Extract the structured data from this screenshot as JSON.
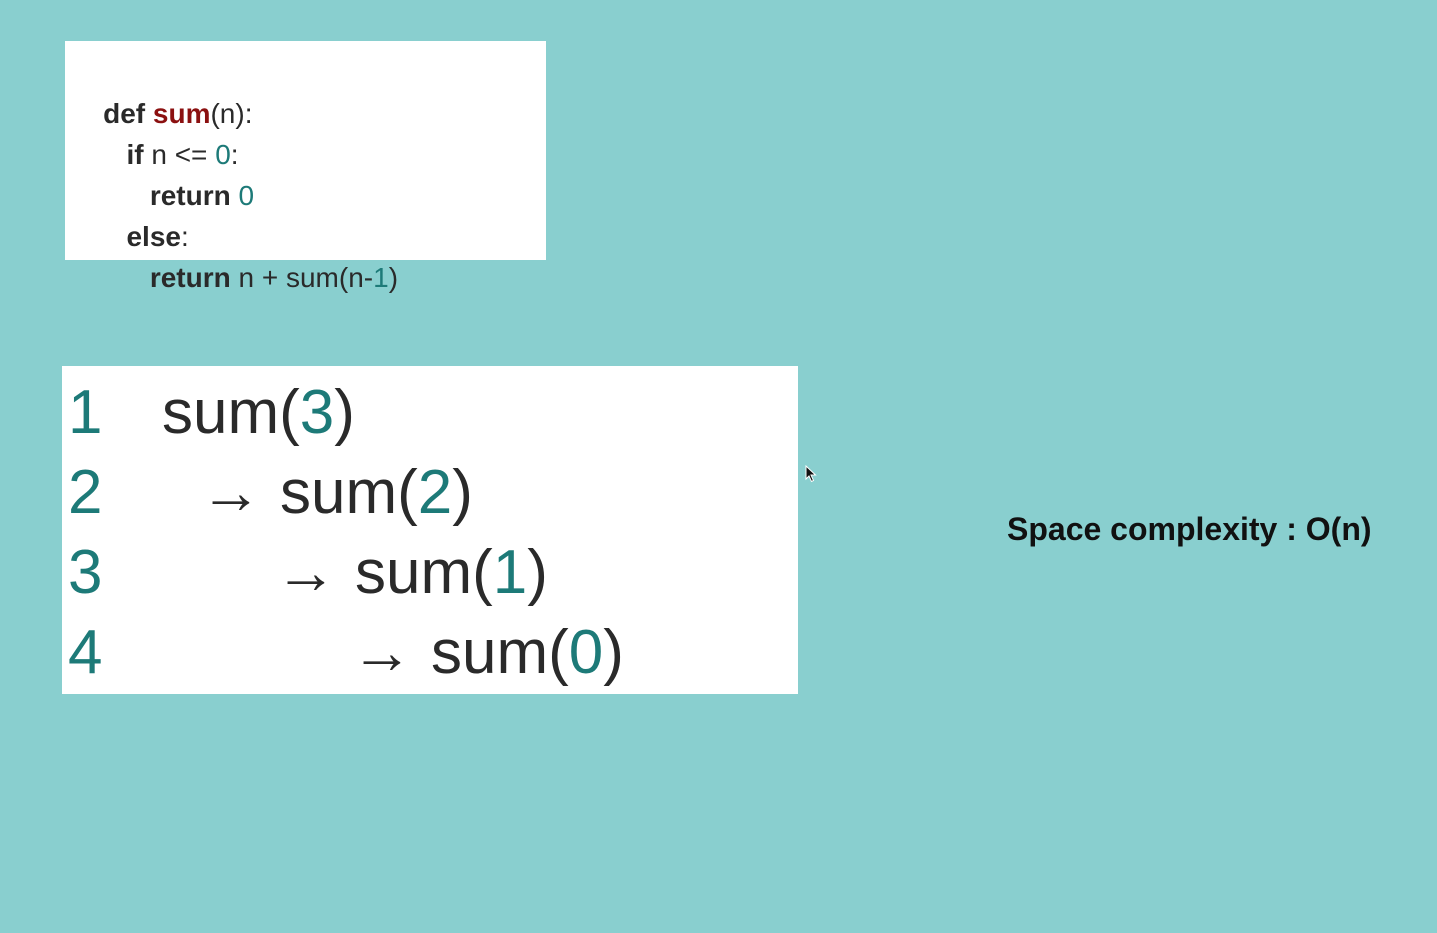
{
  "colors": {
    "background": "#89cfcf",
    "function_name": "#8b1010",
    "number": "#1d7a78",
    "text": "#2a2a2a"
  },
  "code": {
    "lines": [
      {
        "tokens": [
          {
            "text": "def ",
            "style": "kw"
          },
          {
            "text": "sum",
            "style": "fn"
          },
          {
            "text": "(n):",
            "style": "plain"
          }
        ]
      },
      {
        "tokens": [
          {
            "text": "   ",
            "style": "plain"
          },
          {
            "text": "if",
            "style": "kw"
          },
          {
            "text": " n <= ",
            "style": "plain"
          },
          {
            "text": "0",
            "style": "num"
          },
          {
            "text": ":",
            "style": "plain"
          }
        ]
      },
      {
        "tokens": [
          {
            "text": "      ",
            "style": "plain"
          },
          {
            "text": "return",
            "style": "kw"
          },
          {
            "text": " ",
            "style": "plain"
          },
          {
            "text": "0",
            "style": "num"
          }
        ]
      },
      {
        "tokens": [
          {
            "text": "   ",
            "style": "plain"
          },
          {
            "text": "else",
            "style": "kw"
          },
          {
            "text": ":",
            "style": "plain"
          }
        ]
      },
      {
        "tokens": [
          {
            "text": "      ",
            "style": "plain"
          },
          {
            "text": "return",
            "style": "kw"
          },
          {
            "text": " n + sum(n-",
            "style": "plain"
          },
          {
            "text": "1",
            "style": "num"
          },
          {
            "text": ")",
            "style": "plain"
          }
        ]
      }
    ]
  },
  "trace": {
    "rows": [
      {
        "number": "1",
        "arrow": "",
        "call_prefix": "sum(",
        "arg": "3",
        "call_suffix": ")"
      },
      {
        "number": "2",
        "arrow": "→",
        "call_prefix": "sum(",
        "arg": "2",
        "call_suffix": ")"
      },
      {
        "number": "3",
        "arrow": "→",
        "call_prefix": "sum(",
        "arg": "1",
        "call_suffix": ")"
      },
      {
        "number": "4",
        "arrow": "→",
        "call_prefix": "sum(",
        "arg": "0",
        "call_suffix": ")"
      }
    ]
  },
  "complexity_label": "Space complexity : O(n)",
  "icons": {
    "cursor": "mouse-pointer-icon"
  }
}
